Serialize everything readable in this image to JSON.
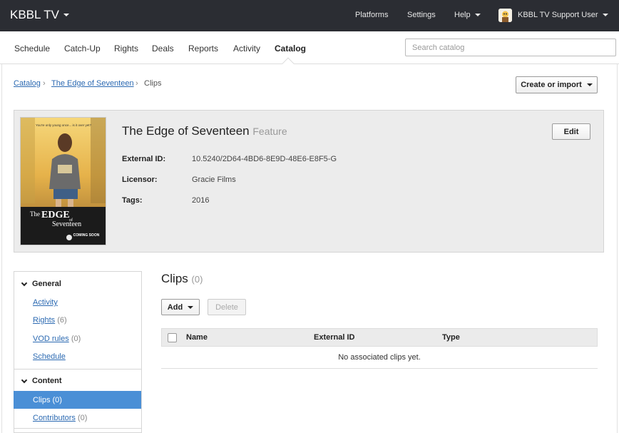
{
  "header": {
    "brand": "KBBL TV",
    "nav": [
      "Platforms",
      "Settings",
      "Help"
    ],
    "user": "KBBL TV Support User"
  },
  "subnav": {
    "items": [
      "Schedule",
      "Catch-Up",
      "Rights",
      "Deals",
      "Reports",
      "Activity",
      "Catalog"
    ],
    "active": "Catalog",
    "search_placeholder": "Search catalog"
  },
  "breadcrumb": {
    "items": [
      "Catalog",
      "The Edge of Seventeen",
      "Clips"
    ]
  },
  "actions": {
    "create_label": "Create or import"
  },
  "item": {
    "title": "The Edge of Seventeen",
    "type": "Feature",
    "edit_label": "Edit",
    "fields": [
      {
        "label": "External ID:",
        "value": "10.5240/2D64-4BD6-8E9D-48E6-E8F5-G"
      },
      {
        "label": "Licensor:",
        "value": "Gracie Films"
      },
      {
        "label": "Tags:",
        "value": "2016"
      }
    ],
    "poster": {
      "tagline": "You're only young once... is it over yet?",
      "title_lines": [
        "The",
        "EDGE",
        "of",
        "Seventeen"
      ],
      "badge": "COMING SOON"
    }
  },
  "sidebar": {
    "general": {
      "heading": "General",
      "items": [
        {
          "label": "Activity",
          "count": ""
        },
        {
          "label": "Rights",
          "count": "(6)"
        },
        {
          "label": "VOD rules",
          "count": "(0)"
        },
        {
          "label": "Schedule",
          "count": ""
        }
      ]
    },
    "content": {
      "heading": "Content",
      "items": [
        {
          "label": "Clips",
          "count": "(0)",
          "active": true
        },
        {
          "label": "Contributors",
          "count": "(0)"
        }
      ]
    }
  },
  "clips": {
    "title": "Clips",
    "count": "(0)",
    "add_label": "Add",
    "delete_label": "Delete",
    "columns": [
      "Name",
      "External ID",
      "Type"
    ],
    "empty_message": "No associated clips yet."
  },
  "colors": {
    "topbar": "#2b2d33",
    "accent": "#4a8fd6",
    "link": "#2c6ab2"
  }
}
